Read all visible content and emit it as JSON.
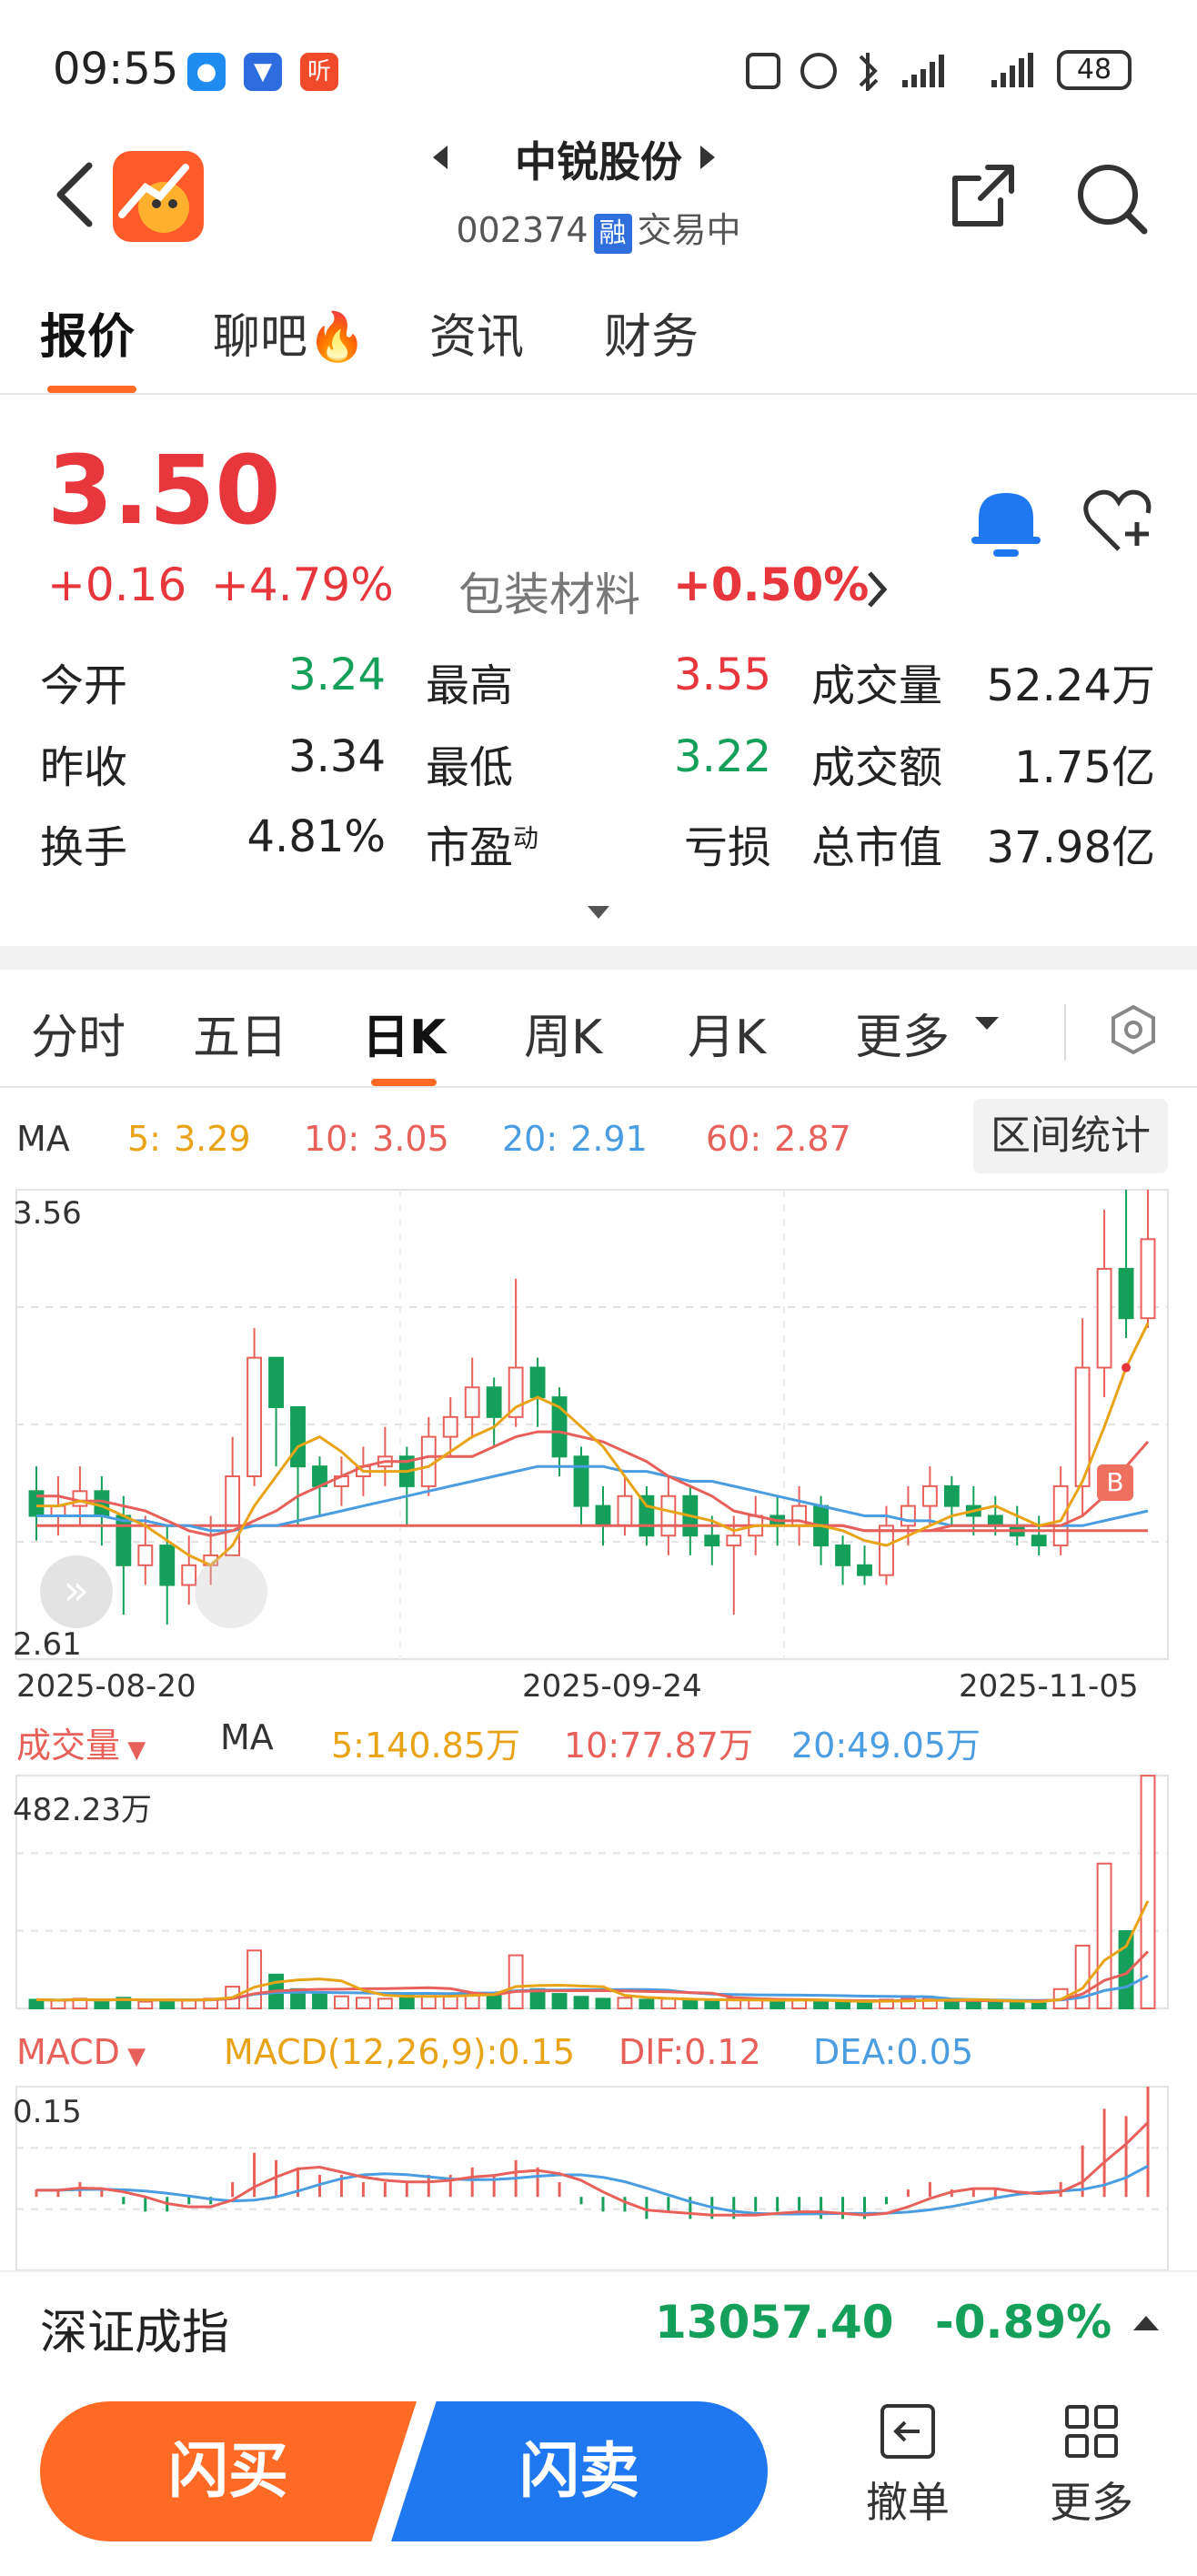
{
  "status_bar": {
    "time": "09:55",
    "battery": "48",
    "listen_label": "听"
  },
  "header": {
    "title": "中锐股份",
    "code": "002374",
    "badge": "融",
    "status": "交易中"
  },
  "tabs": [
    "报价",
    "聊吧",
    "资讯",
    "财务"
  ],
  "quote": {
    "price": "3.50",
    "change": "+0.16",
    "change_pct": "+4.79%",
    "sector": "包装材料",
    "sector_pct": "+0.50%",
    "rows": [
      [
        {
          "l": "今开",
          "v": "3.24",
          "c": "green"
        },
        {
          "l": "最高",
          "v": "3.55",
          "c": "red"
        },
        {
          "l": "成交量",
          "v": "52.24万",
          "c": "dark"
        }
      ],
      [
        {
          "l": "昨收",
          "v": "3.34",
          "c": "dark"
        },
        {
          "l": "最低",
          "v": "3.22",
          "c": "green"
        },
        {
          "l": "成交额",
          "v": "1.75亿",
          "c": "dark"
        }
      ],
      [
        {
          "l": "换手",
          "v": "4.81%",
          "c": "dark"
        },
        {
          "l": "市盈动",
          "v": "亏损",
          "c": "dark"
        },
        {
          "l": "总市值",
          "v": "37.98亿",
          "c": "dark"
        }
      ]
    ]
  },
  "chart_tabs": [
    "分时",
    "五日",
    "日K",
    "周K",
    "月K",
    "更多"
  ],
  "ma": {
    "label": "MA",
    "items": [
      {
        "label": "5:",
        "value": "3.29",
        "color": "#e8a317"
      },
      {
        "label": "10:",
        "value": "3.05",
        "color": "#e8605a"
      },
      {
        "label": "20:",
        "value": "2.91",
        "color": "#4a9de0"
      },
      {
        "label": "60:",
        "value": "2.87",
        "color": "#e8605a"
      }
    ],
    "range_stats": "区间统计"
  },
  "kline_axis": {
    "top": "3.56",
    "bottom": "2.61",
    "dates": [
      "2025-08-20",
      "2025-09-24",
      "2025-11-05"
    ],
    "b_marker": "B"
  },
  "volume": {
    "label": "成交量",
    "ma_label": "MA",
    "items": [
      {
        "text": "5:140.85万",
        "color": "#e8a317"
      },
      {
        "text": "10:77.87万",
        "color": "#e8605a"
      },
      {
        "text": "20:49.05万",
        "color": "#4a9de0"
      }
    ],
    "top": "482.23万"
  },
  "macd": {
    "label": "MACD",
    "items": [
      {
        "text": "MACD(12,26,9):0.15",
        "color": "#e8a317"
      },
      {
        "text": "DIF:0.12",
        "color": "#e8605a"
      },
      {
        "text": "DEA:0.05",
        "color": "#4a9de0"
      }
    ],
    "top": "0.15"
  },
  "index_bar": {
    "name": "深证成指",
    "value": "13057.40",
    "pct": "-0.89%"
  },
  "actions": {
    "buy": "闪买",
    "sell": "闪卖",
    "cancel": "撤单",
    "more": "更多"
  },
  "chart_data": {
    "type": "candlestick",
    "x_ticks": [
      "2025-08-20",
      "2025-09-24",
      "2025-11-05"
    ],
    "ylim": [
      2.61,
      3.56
    ],
    "candles": [
      [
        2.95,
        2.9,
        3.0,
        2.85
      ],
      [
        2.9,
        2.92,
        2.98,
        2.86
      ],
      [
        2.92,
        2.95,
        3.0,
        2.88
      ],
      [
        2.95,
        2.9,
        2.98,
        2.84
      ],
      [
        2.9,
        2.8,
        2.94,
        2.7
      ],
      [
        2.8,
        2.84,
        2.9,
        2.76
      ],
      [
        2.84,
        2.76,
        2.88,
        2.68
      ],
      [
        2.76,
        2.8,
        2.86,
        2.72
      ],
      [
        2.8,
        2.82,
        2.9,
        2.76
      ],
      [
        2.82,
        2.98,
        3.06,
        2.82
      ],
      [
        2.98,
        3.22,
        3.28,
        2.96
      ],
      [
        3.22,
        3.12,
        3.2,
        3.0
      ],
      [
        3.12,
        3.0,
        3.08,
        2.88
      ],
      [
        3.0,
        2.96,
        3.02,
        2.9
      ],
      [
        2.96,
        2.98,
        3.02,
        2.92
      ],
      [
        2.98,
        3.0,
        3.04,
        2.94
      ],
      [
        3.0,
        3.02,
        3.08,
        2.96
      ],
      [
        3.02,
        2.96,
        3.04,
        2.88
      ],
      [
        2.96,
        3.06,
        3.1,
        2.94
      ],
      [
        3.06,
        3.1,
        3.14,
        3.02
      ],
      [
        3.1,
        3.16,
        3.22,
        3.06
      ],
      [
        3.16,
        3.1,
        3.18,
        3.04
      ],
      [
        3.1,
        3.2,
        3.38,
        3.08
      ],
      [
        3.2,
        3.14,
        3.22,
        3.08
      ],
      [
        3.14,
        3.02,
        3.16,
        2.98
      ],
      [
        3.02,
        2.92,
        3.04,
        2.88
      ],
      [
        2.92,
        2.88,
        2.96,
        2.84
      ],
      [
        2.88,
        2.94,
        2.98,
        2.86
      ],
      [
        2.94,
        2.86,
        2.96,
        2.84
      ],
      [
        2.86,
        2.94,
        2.98,
        2.82
      ],
      [
        2.94,
        2.86,
        2.96,
        2.82
      ],
      [
        2.86,
        2.84,
        2.9,
        2.8
      ],
      [
        2.84,
        2.86,
        2.9,
        2.7
      ],
      [
        2.86,
        2.9,
        2.94,
        2.82
      ],
      [
        2.9,
        2.88,
        2.94,
        2.84
      ],
      [
        2.88,
        2.92,
        2.96,
        2.84
      ],
      [
        2.92,
        2.84,
        2.94,
        2.8
      ],
      [
        2.84,
        2.8,
        2.86,
        2.76
      ],
      [
        2.8,
        2.78,
        2.84,
        2.76
      ],
      [
        2.78,
        2.88,
        2.92,
        2.76
      ],
      [
        2.88,
        2.92,
        2.96,
        2.84
      ],
      [
        2.92,
        2.96,
        3.0,
        2.88
      ],
      [
        2.96,
        2.92,
        2.98,
        2.88
      ],
      [
        2.92,
        2.9,
        2.96,
        2.86
      ],
      [
        2.9,
        2.88,
        2.94,
        2.86
      ],
      [
        2.88,
        2.86,
        2.92,
        2.84
      ],
      [
        2.86,
        2.84,
        2.9,
        2.82
      ],
      [
        2.84,
        2.96,
        3.0,
        2.82
      ],
      [
        2.96,
        3.2,
        3.3,
        2.9
      ],
      [
        3.2,
        3.4,
        3.52,
        3.14
      ],
      [
        3.4,
        3.3,
        3.56,
        3.26
      ],
      [
        3.3,
        3.46,
        3.56,
        3.28
      ]
    ],
    "volume_ylim": [
      0,
      482.23
    ],
    "volume": [
      18,
      16,
      20,
      15,
      22,
      14,
      18,
      16,
      20,
      45,
      120,
      70,
      40,
      30,
      25,
      22,
      20,
      28,
      30,
      26,
      32,
      28,
      110,
      40,
      30,
      24,
      20,
      22,
      18,
      20,
      16,
      14,
      20,
      18,
      16,
      18,
      14,
      12,
      12,
      18,
      20,
      22,
      16,
      14,
      12,
      12,
      14,
      40,
      130,
      300,
      160,
      482
    ],
    "macd_ylim": [
      -0.1,
      0.15
    ],
    "macd": [
      0.01,
      0.01,
      0.02,
      0.01,
      -0.01,
      -0.02,
      -0.02,
      -0.01,
      -0.01,
      0.02,
      0.06,
      0.05,
      0.04,
      0.03,
      0.03,
      0.02,
      0.02,
      0.02,
      0.03,
      0.03,
      0.04,
      0.03,
      0.05,
      0.04,
      0.02,
      -0.01,
      -0.02,
      -0.02,
      -0.03,
      -0.02,
      -0.03,
      -0.03,
      -0.03,
      -0.02,
      -0.02,
      -0.02,
      -0.03,
      -0.03,
      -0.03,
      -0.01,
      0.01,
      0.02,
      0.01,
      0.01,
      0.01,
      0.0,
      0.0,
      0.02,
      0.07,
      0.12,
      0.11,
      0.15
    ],
    "ma5": [
      2.92,
      2.92,
      2.93,
      2.92,
      2.9,
      2.88,
      2.85,
      2.82,
      2.8,
      2.84,
      2.92,
      2.98,
      3.04,
      3.06,
      3.03,
      2.99,
      2.99,
      2.99,
      3.0,
      3.03,
      3.06,
      3.08,
      3.12,
      3.14,
      3.12,
      3.08,
      3.04,
      2.98,
      2.92,
      2.91,
      2.9,
      2.89,
      2.87,
      2.88,
      2.88,
      2.88,
      2.88,
      2.87,
      2.85,
      2.84,
      2.86,
      2.88,
      2.9,
      2.91,
      2.92,
      2.9,
      2.88,
      2.89,
      2.97,
      3.08,
      3.2,
      3.29
    ],
    "ma10": [
      2.94,
      2.94,
      2.93,
      2.93,
      2.92,
      2.91,
      2.89,
      2.87,
      2.86,
      2.87,
      2.89,
      2.91,
      2.94,
      2.96,
      2.98,
      3.0,
      3.01,
      3.01,
      3.02,
      3.02,
      3.02,
      3.04,
      3.06,
      3.07,
      3.07,
      3.06,
      3.05,
      3.03,
      3.01,
      2.98,
      2.96,
      2.94,
      2.91,
      2.9,
      2.89,
      2.89,
      2.88,
      2.88,
      2.87,
      2.87,
      2.87,
      2.87,
      2.88,
      2.88,
      2.88,
      2.88,
      2.88,
      2.88,
      2.9,
      2.94,
      3.0,
      3.05
    ],
    "ma20": [
      2.9,
      2.9,
      2.9,
      2.9,
      2.89,
      2.89,
      2.88,
      2.88,
      2.87,
      2.87,
      2.88,
      2.88,
      2.89,
      2.9,
      2.91,
      2.92,
      2.93,
      2.94,
      2.95,
      2.96,
      2.97,
      2.98,
      2.99,
      3.0,
      3.0,
      3.0,
      3.0,
      2.99,
      2.99,
      2.98,
      2.97,
      2.97,
      2.96,
      2.95,
      2.94,
      2.93,
      2.92,
      2.91,
      2.9,
      2.9,
      2.89,
      2.89,
      2.88,
      2.88,
      2.88,
      2.88,
      2.88,
      2.88,
      2.88,
      2.89,
      2.9,
      2.91
    ],
    "ma60": [
      2.88,
      2.88,
      2.88,
      2.88,
      2.88,
      2.88,
      2.88,
      2.88,
      2.88,
      2.88,
      2.88,
      2.88,
      2.88,
      2.88,
      2.88,
      2.88,
      2.88,
      2.88,
      2.88,
      2.88,
      2.88,
      2.88,
      2.88,
      2.88,
      2.88,
      2.88,
      2.88,
      2.88,
      2.88,
      2.88,
      2.88,
      2.88,
      2.88,
      2.88,
      2.88,
      2.88,
      2.88,
      2.88,
      2.87,
      2.87,
      2.87,
      2.87,
      2.87,
      2.87,
      2.87,
      2.87,
      2.87,
      2.87,
      2.87,
      2.87,
      2.87,
      2.87
    ]
  }
}
